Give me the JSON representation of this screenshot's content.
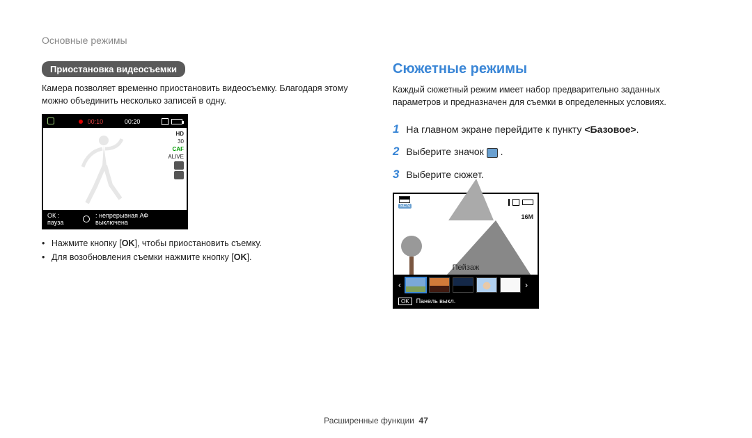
{
  "header": "Основные режимы",
  "left": {
    "pill": "Приостановка видеосъемки",
    "para": "Камера позволяет временно приостановить видеосъемку. Благодаря этому можно объединить несколько записей в одну.",
    "video": {
      "time_elapsed": "00:10",
      "time_remaining": "00:20",
      "badges": {
        "hd": "HD",
        "fps": "30",
        "caf": "CAF",
        "live": "ALIVE"
      },
      "status_ok": "ОК : пауза",
      "status_af": ": непрерывная АФ выключена"
    },
    "bullets": {
      "b1a": "Нажмите кнопку [",
      "b1b": "OK",
      "b1c": "], чтобы приостановить съемку.",
      "b2a": "Для возобновления съемки нажмите кнопку [",
      "b2b": "OK",
      "b2c": "]."
    }
  },
  "right": {
    "title": "Сюжетные режимы",
    "para": "Каждый сюжетный режим имеет набор предварительно заданных параметров и предназначен для съемки в определенных условиях.",
    "steps": {
      "s1a": "На главном экране перейдите к пункту ",
      "s1b": "<Базовое>",
      "s1c": ".",
      "s2a": "Выберите значок ",
      "s2b": ".",
      "s3": "Выберите сюжет."
    },
    "scene": {
      "tag": "SCN",
      "res": "16M",
      "label": "Пейзаж",
      "ok": "OK",
      "panel": "Панель выкл."
    }
  },
  "footer": {
    "label": "Расширенные функции",
    "page": "47"
  }
}
